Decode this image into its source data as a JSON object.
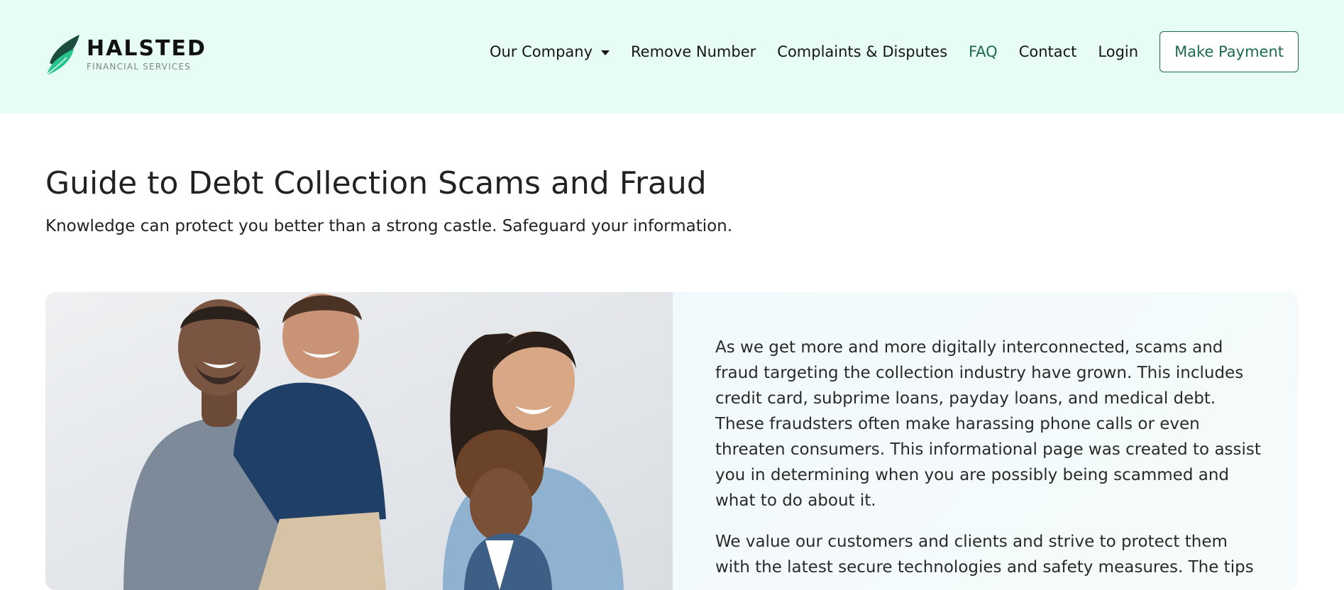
{
  "brand": {
    "name": "HALSTED",
    "subtitle": "FINANCIAL SERVICES",
    "colors": {
      "accent": "#1d6a50",
      "header_bg": "#e6fcf5",
      "logo_green": "#27c48c"
    }
  },
  "nav": {
    "items": [
      {
        "label": "Our Company",
        "dropdown": true,
        "active": false
      },
      {
        "label": "Remove Number",
        "dropdown": false,
        "active": false
      },
      {
        "label": "Complaints & Disputes",
        "dropdown": false,
        "active": false
      },
      {
        "label": "FAQ",
        "dropdown": false,
        "active": true
      },
      {
        "label": "Contact",
        "dropdown": false,
        "active": false
      },
      {
        "label": "Login",
        "dropdown": false,
        "active": false
      }
    ],
    "cta_label": "Make Payment"
  },
  "main": {
    "title": "Guide to Debt Collection Scams and Fraud",
    "subtitle": "Knowledge can protect you better than a strong castle. Safeguard your information.",
    "paragraphs": [
      "As we get more and more digitally interconnected, scams and fraud targeting the collection industry have grown. This includes credit card, subprime loans, payday loans, and medical debt. These fraudsters often make harassing phone calls or even threaten consumers. This informational page was created to assist you in determining when you are possibly being scammed and what to do about it.",
      "We value our customers and clients and strive to protect them with the latest secure technologies and safety measures. The tips"
    ]
  }
}
